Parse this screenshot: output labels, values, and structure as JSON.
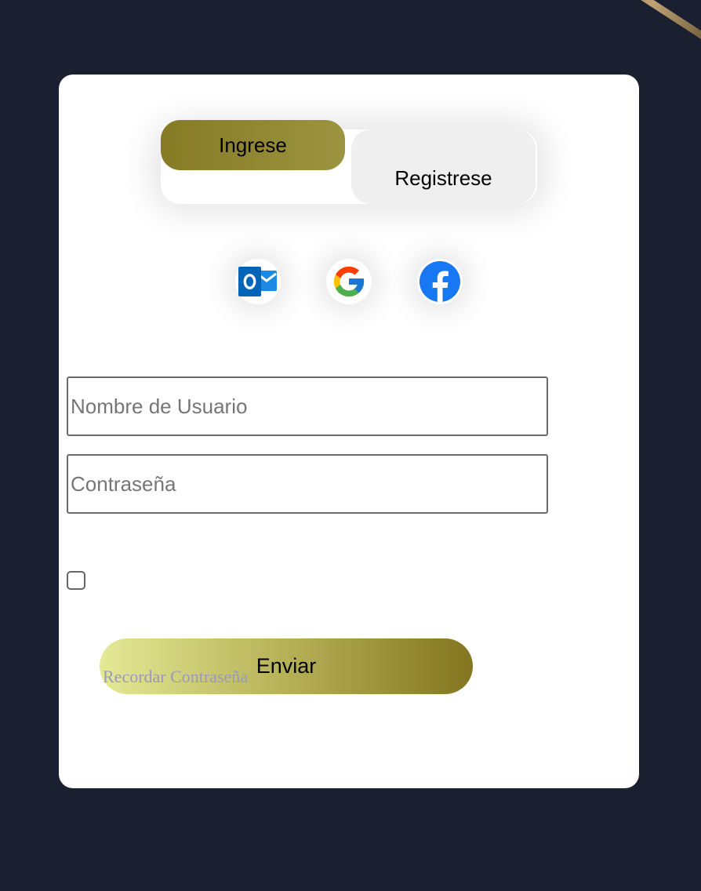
{
  "tabs": {
    "login_label": "Ingrese",
    "register_label": "Registrese"
  },
  "social": {
    "icons": [
      "outlook-icon",
      "google-icon",
      "facebook-icon"
    ]
  },
  "form": {
    "username_placeholder": "Nombre de Usuario",
    "password_placeholder": "Contraseña",
    "remember_label": "Recordar Contraseña",
    "submit_label": "Enviar"
  },
  "colors": {
    "background": "#1b2030",
    "card": "#ffffff",
    "accent_gold": "#867a25",
    "submit_gradient_start": "#e4e995",
    "submit_gradient_end": "#847521",
    "remember_text": "#9a9ab8"
  }
}
